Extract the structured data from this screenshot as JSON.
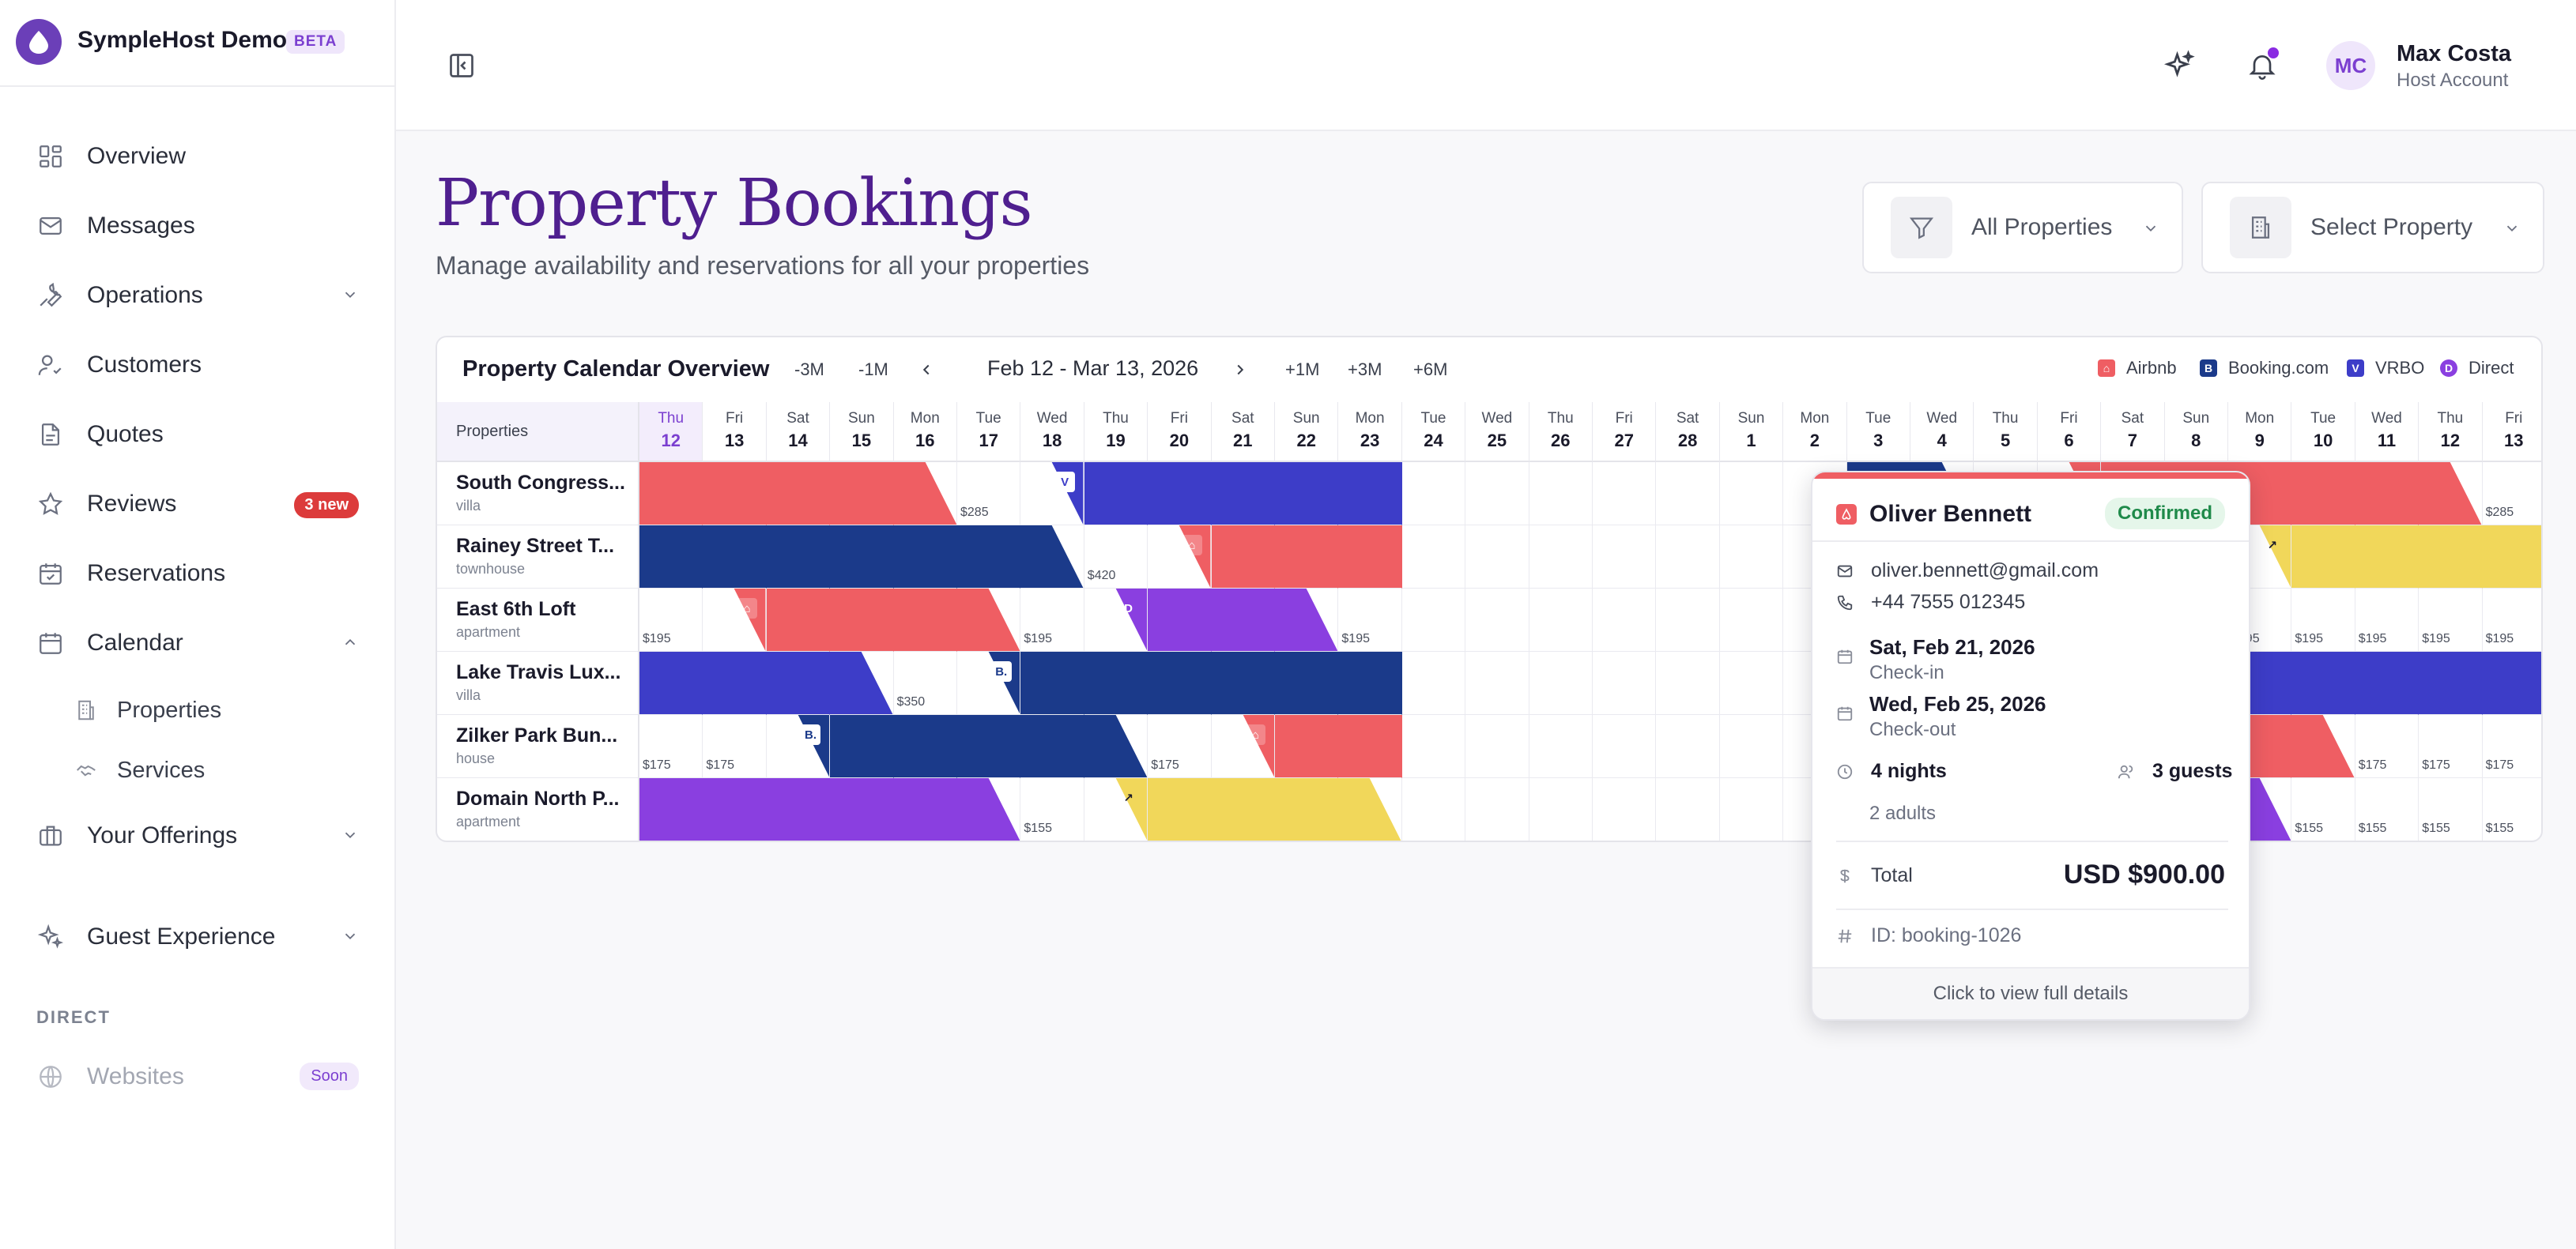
{
  "app": {
    "name": "SympleHost Demo",
    "badge": "BETA"
  },
  "sidebar": {
    "items": [
      {
        "label": "Overview",
        "icon": "grid-icon"
      },
      {
        "label": "Messages",
        "icon": "mail-icon"
      },
      {
        "label": "Operations",
        "icon": "wrench-icon"
      },
      {
        "label": "Customers",
        "icon": "users-icon"
      },
      {
        "label": "Quotes",
        "icon": "document-icon"
      },
      {
        "label": "Reviews",
        "icon": "star-icon",
        "badge": "3 new"
      },
      {
        "label": "Reservations",
        "icon": "calendar-check-icon"
      },
      {
        "label": "Calendar",
        "icon": "calendar-icon"
      },
      {
        "label": "Properties",
        "icon": "building-icon"
      },
      {
        "label": "Services",
        "icon": "handshake-icon"
      },
      {
        "label": "Your Offerings",
        "icon": "briefcase-icon"
      },
      {
        "label": "Guest Experience",
        "icon": "sparkles-icon"
      }
    ],
    "section_direct": "DIRECT",
    "websites": {
      "label": "Websites",
      "badge": "Soon"
    }
  },
  "header": {
    "user_initials": "MC",
    "user_name": "Max Costa",
    "user_role": "Host Account"
  },
  "page": {
    "title": "Property Bookings",
    "subtitle": "Manage availability and reservations for all your properties",
    "filter_all": "All Properties",
    "filter_select": "Select Property"
  },
  "calendar": {
    "title": "Property Calendar Overview",
    "nav_back": [
      "-3M",
      "-1M"
    ],
    "nav_fwd": [
      "+1M",
      "+3M",
      "+6M"
    ],
    "range": "Feb 12 - Mar 13, 2026",
    "legend": [
      {
        "label": "Airbnb",
        "color": "#ef5e63",
        "mark": "A"
      },
      {
        "label": "Booking.com",
        "color": "#1b3a8a",
        "mark": "B."
      },
      {
        "label": "VRBO",
        "color": "#3d3dc8",
        "mark": "V"
      },
      {
        "label": "Direct",
        "color": "#8a3fe0",
        "mark": "D"
      }
    ],
    "properties_header": "Properties",
    "days": [
      {
        "d": "Thu",
        "n": "12"
      },
      {
        "d": "Fri",
        "n": "13"
      },
      {
        "d": "Sat",
        "n": "14"
      },
      {
        "d": "Sun",
        "n": "15"
      },
      {
        "d": "Mon",
        "n": "16"
      },
      {
        "d": "Tue",
        "n": "17"
      },
      {
        "d": "Wed",
        "n": "18"
      },
      {
        "d": "Thu",
        "n": "19"
      },
      {
        "d": "Fri",
        "n": "20"
      },
      {
        "d": "Sat",
        "n": "21"
      },
      {
        "d": "Sun",
        "n": "22"
      },
      {
        "d": "Mon",
        "n": "23"
      },
      {
        "d": "Tue",
        "n": "24"
      },
      {
        "d": "Wed",
        "n": "25"
      },
      {
        "d": "Thu",
        "n": "26"
      },
      {
        "d": "Fri",
        "n": "27"
      },
      {
        "d": "Sat",
        "n": "28"
      },
      {
        "d": "Sun",
        "n": "1"
      },
      {
        "d": "Mon",
        "n": "2"
      },
      {
        "d": "Tue",
        "n": "3"
      },
      {
        "d": "Wed",
        "n": "4"
      },
      {
        "d": "Thu",
        "n": "5"
      },
      {
        "d": "Fri",
        "n": "6"
      },
      {
        "d": "Sat",
        "n": "7"
      },
      {
        "d": "Sun",
        "n": "8"
      },
      {
        "d": "Mon",
        "n": "9"
      },
      {
        "d": "Tue",
        "n": "10"
      },
      {
        "d": "Wed",
        "n": "11"
      },
      {
        "d": "Thu",
        "n": "12"
      },
      {
        "d": "Fri",
        "n": "13"
      }
    ],
    "properties": [
      {
        "name": "South Congress...",
        "type": "villa",
        "cells": [
          "A",
          "A",
          "A",
          "A",
          "A>",
          "$285",
          "V<",
          "V",
          "V",
          "V",
          "V",
          "V",
          "",
          "",
          "",
          "",
          "",
          "",
          "",
          "B",
          "B>",
          "$285",
          "A<",
          "A",
          "A",
          "A",
          "A",
          "A",
          "A>",
          "$285"
        ]
      },
      {
        "name": "Rainey Street T...",
        "type": "townhouse",
        "cells": [
          "B",
          "B",
          "B",
          "B",
          "B",
          "B",
          "B>",
          "$420",
          "A<",
          "A",
          "A",
          "A",
          "",
          "",
          "",
          "",
          "",
          "",
          "",
          "A",
          "A",
          "A",
          "A",
          "A>",
          "$550",
          "Y<",
          "Y",
          "Y",
          "Y",
          "Y"
        ]
      },
      {
        "name": "East 6th Loft",
        "type": "apartment",
        "cells": [
          "$195",
          "A<",
          "A",
          "A",
          "A",
          "A>",
          "$195",
          "D<",
          "D",
          "D",
          "D>",
          "$195",
          "",
          "",
          "",
          "",
          "",
          "",
          "",
          "B",
          "B",
          "B",
          "B>",
          "$265",
          "$265",
          "$195",
          "$195",
          "$195",
          "$195",
          "$195"
        ]
      },
      {
        "name": "Lake Travis Lux...",
        "type": "villa",
        "cells": [
          "V",
          "V",
          "V",
          "V>",
          "$350",
          "B<",
          "B",
          "B",
          "B",
          "B",
          "B",
          "B",
          "",
          "",
          "",
          "",
          "",
          "",
          "",
          "D",
          "D",
          "D>",
          "$350",
          "V<",
          "V",
          "V",
          "V",
          "V",
          "V",
          "V"
        ]
      },
      {
        "name": "Zilker Park Bun...",
        "type": "house",
        "cells": [
          "$175",
          "$175",
          "B<",
          "B",
          "B",
          "B",
          "B",
          "B>",
          "$175",
          "A<",
          "A",
          "A",
          "",
          "",
          "",
          "",
          "",
          "",
          "",
          "B>",
          "$175",
          "A<",
          "A",
          "A",
          "A",
          "A",
          "A>",
          "$175",
          "$175",
          "$175"
        ]
      },
      {
        "name": "Domain North P...",
        "type": "apartment",
        "cells": [
          "D",
          "D",
          "D",
          "D",
          "D",
          "D>",
          "$155",
          "Y<",
          "Y",
          "Y",
          "Y",
          "Y>",
          "",
          "",
          "",
          "",
          "",
          "",
          "",
          "$155",
          "D<",
          "D",
          "D",
          "D",
          "D",
          "D>",
          "$155",
          "$155",
          "$155",
          "$155"
        ]
      }
    ]
  },
  "popover": {
    "guest": "Oliver Bennett",
    "status": "Confirmed",
    "email": "oliver.bennett@gmail.com",
    "phone": "+44 7555 012345",
    "checkin_date": "Sat, Feb 21, 2026",
    "checkin_label": "Check-in",
    "checkout_date": "Wed, Feb 25, 2026",
    "checkout_label": "Check-out",
    "nights": "4 nights",
    "guests": "3 guests",
    "adults": "2 adults",
    "total_label": "Total",
    "total_value": "USD $900.00",
    "booking_id": "ID: booking-1026",
    "footer": "Click to view full details"
  },
  "colors": {
    "airbnb": "#ef5e63",
    "booking": "#1b3a8a",
    "vrbo": "#3d3dc8",
    "direct": "#8a3fe0",
    "yellow": "#f1d75a",
    "brand": "#4f1f8f"
  }
}
